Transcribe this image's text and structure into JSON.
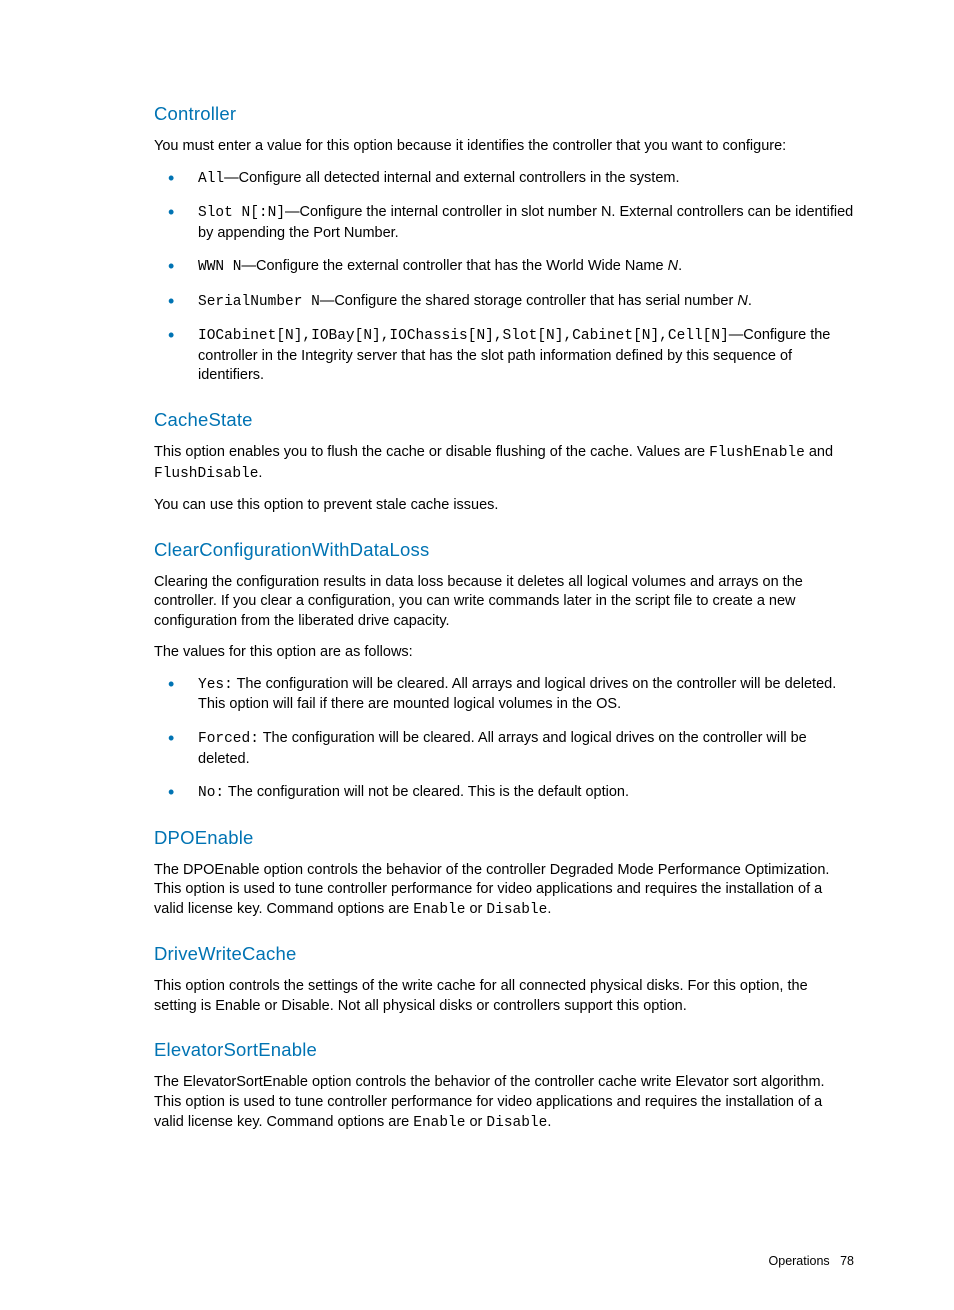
{
  "sections": {
    "controller": {
      "title": "Controller",
      "intro": "You must enter a value for this option because it identifies the controller that you want to configure:",
      "items": {
        "all_code": "All",
        "all_text": "—Configure all detected internal and external controllers in the system.",
        "slot_code": "Slot N[:N]",
        "slot_text": "—Configure the internal controller in slot number N. External controllers can be identified by appending the Port Number.",
        "wwn_code": "WWN N",
        "wwn_text_a": "—Configure the external controller that has the World Wide Name ",
        "wwn_n": "N",
        "wwn_text_b": ".",
        "serial_code": "SerialNumber N",
        "serial_text_a": "—Configure the shared storage controller that has serial number ",
        "serial_n": "N",
        "serial_text_b": ".",
        "io_code": "IOCabinet[N],IOBay[N],IOChassis[N],Slot[N],Cabinet[N],Cell[N]",
        "io_text": "—Configure the controller in the Integrity server that has the slot path information defined by this sequence of identifiers."
      }
    },
    "cachestate": {
      "title": "CacheState",
      "p1a": "This option enables you to flush the cache or disable flushing of the cache. Values are ",
      "p1b": "FlushEnable",
      "p1c": " and ",
      "p1d": "FlushDisable",
      "p1e": ".",
      "p2": "You can use this option to prevent stale cache issues."
    },
    "clearconfig": {
      "title": "ClearConfigurationWithDataLoss",
      "p1": "Clearing the configuration results in data loss because it deletes all logical volumes and arrays on the controller. If you clear a configuration, you can write commands later in the script file to create a new configuration from the liberated drive capacity.",
      "p2": "The values for this option are as follows:",
      "items": {
        "yes_code": "Yes:",
        "yes_text": " The configuration will be cleared. All arrays and logical drives on the controller will be deleted. This option will fail if there are mounted logical volumes in the OS.",
        "forced_code": "Forced:",
        "forced_text": " The configuration will be cleared. All arrays and logical drives on the controller will be deleted.",
        "no_code": "No:",
        "no_text": " The configuration will not be cleared. This is the default option."
      }
    },
    "dpo": {
      "title": "DPOEnable",
      "p1a": "The DPOEnable option controls the behavior of the controller Degraded Mode Performance Optimization. This option is used to tune controller performance for video applications and requires the installation of a valid license key. Command options are ",
      "p1b": "Enable",
      "p1c": " or ",
      "p1d": "Disable",
      "p1e": "."
    },
    "dwc": {
      "title": "DriveWriteCache",
      "p1": "This option controls the settings of the write cache for all connected physical disks. For this option, the setting is Enable or Disable. Not all physical disks or controllers support this option."
    },
    "esort": {
      "title": "ElevatorSortEnable",
      "p1a": "The ElevatorSortEnable option controls the behavior of the controller cache write Elevator sort algorithm. This option is used to tune controller performance for video applications and requires the installation of a valid license key. Command options are ",
      "p1b": "Enable",
      "p1c": " or ",
      "p1d": "Disable",
      "p1e": "."
    }
  },
  "footer": {
    "label": "Operations",
    "page": "78"
  }
}
